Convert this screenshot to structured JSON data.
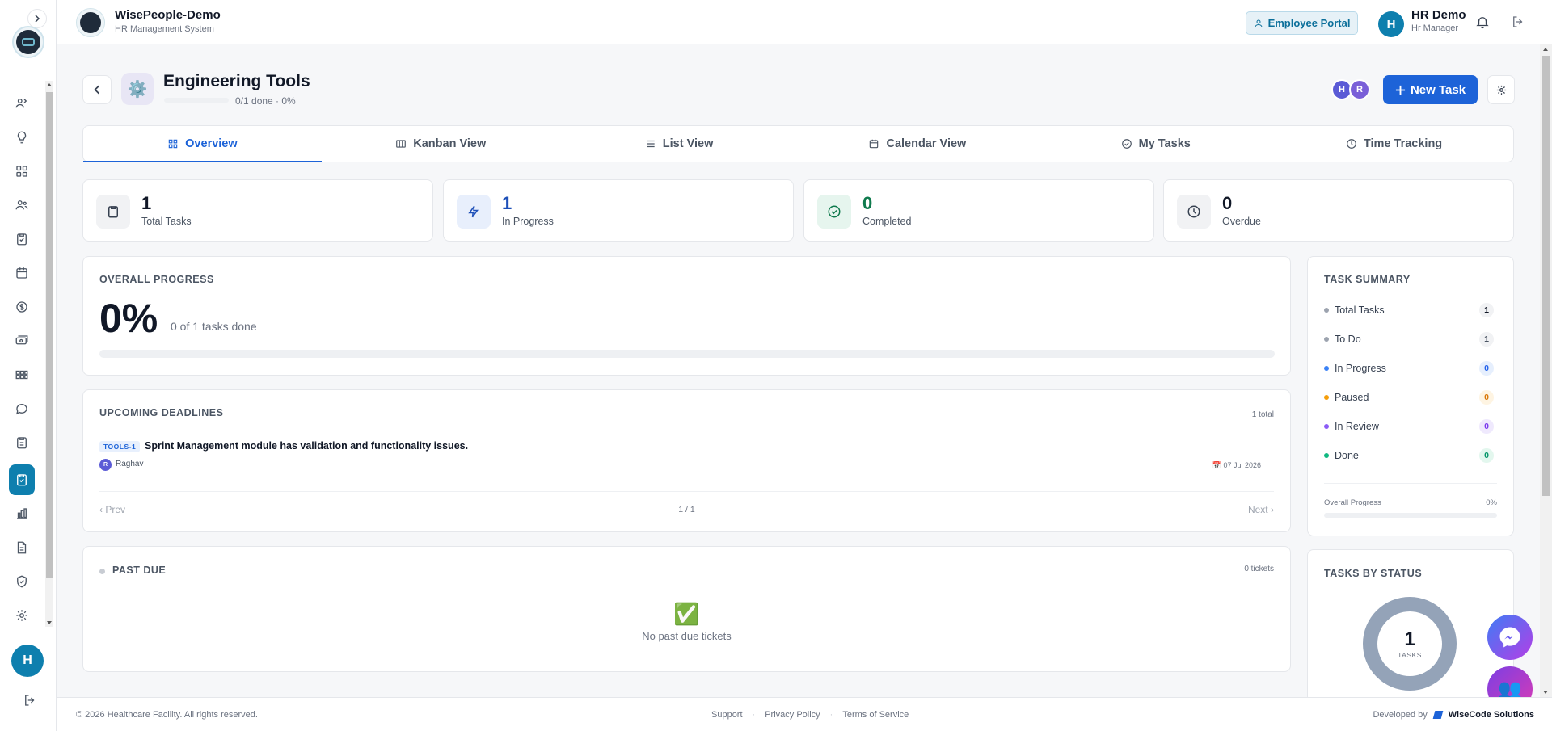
{
  "app": {
    "name": "WisePeople-Demo",
    "subtitle": "HR Management System",
    "employee_portal_label": "Employee Portal"
  },
  "user": {
    "initial": "H",
    "name": "HR Demo",
    "role": "Hr Manager"
  },
  "sidebar": {
    "avatar_initial": "H",
    "items": [
      {
        "icon": "users-switch-icon"
      },
      {
        "icon": "lightbulb-icon"
      },
      {
        "icon": "dashboard-grid-icon"
      },
      {
        "icon": "people-icon"
      },
      {
        "icon": "clipboard-check-icon"
      },
      {
        "icon": "calendar-icon"
      },
      {
        "icon": "dollar-icon"
      },
      {
        "icon": "money-icon"
      },
      {
        "icon": "org-grid-icon"
      },
      {
        "icon": "chat-icon"
      },
      {
        "icon": "clipboard-icon"
      },
      {
        "icon": "tasks-icon",
        "active": true
      },
      {
        "icon": "bar-chart-icon"
      },
      {
        "icon": "document-icon"
      },
      {
        "icon": "shield-icon"
      },
      {
        "icon": "settings-icon"
      }
    ]
  },
  "project": {
    "title": "Engineering Tools",
    "progress_text": "0/1 done · 0%",
    "progress_fraction": 0,
    "members": [
      "H",
      "R"
    ],
    "new_task_label": "New Task"
  },
  "tabs": [
    {
      "label": "Overview",
      "icon": "overview-icon",
      "active": true
    },
    {
      "label": "Kanban View",
      "icon": "kanban-icon"
    },
    {
      "label": "List View",
      "icon": "list-icon"
    },
    {
      "label": "Calendar View",
      "icon": "calendar-icon"
    },
    {
      "label": "My Tasks",
      "icon": "check-circle-icon"
    },
    {
      "label": "Time Tracking",
      "icon": "clock-icon"
    }
  ],
  "stats": [
    {
      "value": "1",
      "label": "Total Tasks",
      "icon": "clipboard-icon",
      "color": "#111827"
    },
    {
      "value": "1",
      "label": "In Progress",
      "icon": "lightning-icon",
      "color": "#1d4fb8"
    },
    {
      "value": "0",
      "label": "Completed",
      "icon": "check-circle-icon",
      "color": "#0f7a4d"
    },
    {
      "value": "0",
      "label": "Overdue",
      "icon": "clock-icon",
      "color": "#111827"
    }
  ],
  "overall_progress": {
    "heading": "OVERALL PROGRESS",
    "percent_text": "0%",
    "subtext": "0 of 1 tasks done",
    "fraction": 0
  },
  "deadlines": {
    "heading": "UPCOMING DEADLINES",
    "count_text": "1 total",
    "items": [
      {
        "tag": "TOOLS-1",
        "title": "Sprint Management module has validation and functionality issues.",
        "assignee_initial": "R",
        "assignee": "Raghav",
        "date": "📅 07 Jul 2026"
      }
    ],
    "prev_label": "Prev",
    "next_label": "Next",
    "page_text": "1 / 1"
  },
  "past_due": {
    "heading": "PAST DUE",
    "count_text": "0 tickets",
    "empty_icon": "✅",
    "empty_text": "No past due tickets"
  },
  "task_summary": {
    "heading": "TASK SUMMARY",
    "rows": [
      {
        "name": "Total Tasks",
        "count": "1",
        "dot": "#9ca3af",
        "bg": "#f1f2f4",
        "fg": "#111827"
      },
      {
        "name": "To Do",
        "count": "1",
        "dot": "#9ca3af",
        "bg": "#f1f2f4",
        "fg": "#4b5563"
      },
      {
        "name": "In Progress",
        "count": "0",
        "dot": "#3b82f6",
        "bg": "#e6effd",
        "fg": "#2563eb"
      },
      {
        "name": "Paused",
        "count": "0",
        "dot": "#f59e0b",
        "bg": "#fef4e2",
        "fg": "#d97706"
      },
      {
        "name": "In Review",
        "count": "0",
        "dot": "#8b5cf6",
        "bg": "#efe9fd",
        "fg": "#7c3aed"
      },
      {
        "name": "Done",
        "count": "0",
        "dot": "#10b981",
        "bg": "#e3f7ee",
        "fg": "#059669"
      }
    ],
    "progress_label": "Overall Progress",
    "progress_value": "0%"
  },
  "tasks_by_status": {
    "heading": "TASKS BY STATUS",
    "total": "1",
    "caption": "TASKS"
  },
  "footer": {
    "copyright": "© 2026 Healthcare Facility. All rights reserved.",
    "links": [
      "Support",
      "Privacy Policy",
      "Terms of Service"
    ],
    "developed_by": "Developed by",
    "developer": "WiseCode Solutions"
  }
}
